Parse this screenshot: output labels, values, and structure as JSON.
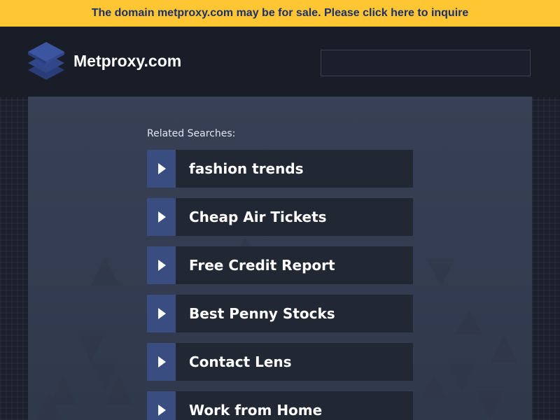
{
  "banner": {
    "text": "The domain metproxy.com may be for sale. Please click here to inquire"
  },
  "header": {
    "site_name": "Metproxy.com",
    "search_value": ""
  },
  "main": {
    "related_label": "Related Searches:",
    "links": [
      {
        "label": "fashion trends"
      },
      {
        "label": "Cheap Air Tickets"
      },
      {
        "label": "Free Credit Report"
      },
      {
        "label": "Best Penny Stocks"
      },
      {
        "label": "Contact Lens"
      },
      {
        "label": "Work from Home"
      }
    ]
  },
  "colors": {
    "banner_bg": "#fdc632",
    "banner_text": "#1e2f6b",
    "header_bg": "#191d28",
    "panel_bg": "#363e53",
    "link_bg": "#222734",
    "arrow_bg": "#3a4d80"
  },
  "icons": {
    "logo": "stacked-layers-icon",
    "link_arrow": "play-arrow-icon"
  }
}
